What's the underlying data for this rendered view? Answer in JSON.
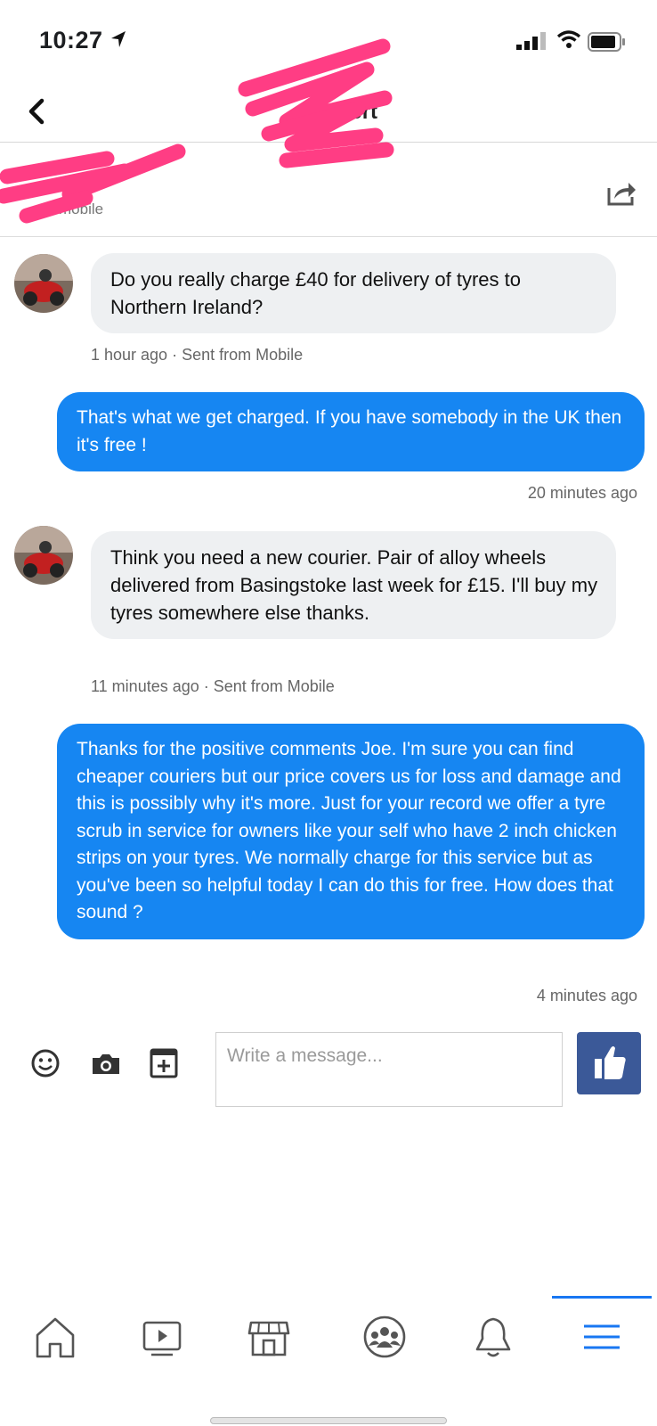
{
  "status_bar": {
    "time": "10:27"
  },
  "nav": {
    "title_fragment": "vert"
  },
  "subheader": {
    "name_fragment": "aive",
    "status_fragment": "mobile"
  },
  "messages": [
    {
      "direction": "incoming",
      "text": "Do you really charge £40 for delivery of tyres to Northern Ireland?",
      "meta": "1 hour ago · Sent from Mobile"
    },
    {
      "direction": "outgoing",
      "text": "That's what we get charged. If you have somebody in the UK then it's free !",
      "meta": "20 minutes ago"
    },
    {
      "direction": "incoming",
      "text": "Think you need a new courier. Pair of alloy wheels delivered from Basingstoke last week for £15. I'll buy my tyres somewhere else thanks.",
      "meta": "11 minutes ago · Sent from Mobile"
    },
    {
      "direction": "outgoing",
      "text": "Thanks for the positive comments Joe. I'm sure you can find cheaper couriers but our price covers us for loss and damage and this is possibly why it's more. Just for your record we offer a tyre scrub in service for owners like your self who have 2 inch chicken strips on your tyres. We normally charge for this service but as you've been so helpful today I can do this for free. How does that sound ?",
      "meta": "4 minutes ago"
    }
  ],
  "composer": {
    "placeholder": "Write a message..."
  },
  "icons": {
    "composer": [
      "emoji-icon",
      "camera-icon",
      "add-icon",
      "like-icon"
    ],
    "tabs": [
      "home-icon",
      "watch-icon",
      "marketplace-icon",
      "groups-icon",
      "notifications-icon",
      "menu-icon"
    ]
  },
  "colors": {
    "outgoing_bubble": "#1686f2",
    "incoming_bubble": "#eef0f2",
    "like_button": "#3b5998",
    "active_tab": "#1877f2",
    "redaction": "#ff3d84"
  }
}
